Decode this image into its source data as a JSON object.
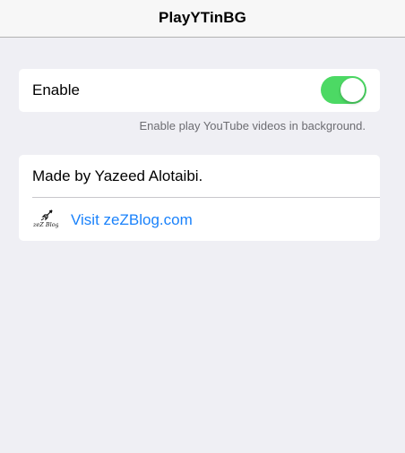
{
  "navbar": {
    "title": "PlayYTinBG"
  },
  "enable_section": {
    "label": "Enable",
    "toggle_on": true,
    "toggle_color": "#4cd964",
    "footer": "Enable play YouTube videos in background."
  },
  "about_section": {
    "made_by": "Made by Yazeed Alotaibi.",
    "link_label": "Visit zeZBlog.com",
    "link_color": "#1a82fb",
    "logo_text": "zeZ Blog",
    "logo_icon": "rocket-icon"
  }
}
